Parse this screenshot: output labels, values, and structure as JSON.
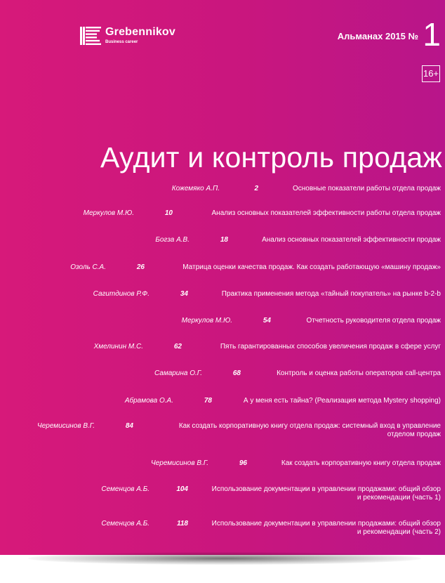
{
  "brand": {
    "name": "Grebennikov",
    "tagline": "Business career",
    "icon": "grebennikov-logo-icon"
  },
  "header": {
    "almanac_label": "Альманах 2015 №",
    "issue_number": "1",
    "age_rating": "16+"
  },
  "title": "Аудит и контроль продаж",
  "colors": {
    "background": "#d01880",
    "text": "#ffffff"
  },
  "toc": [
    {
      "author": "Кожемяко А.П.",
      "page": "2",
      "title": "Основные показатели работы отдела продаж"
    },
    {
      "author": "Меркулов М.Ю.",
      "page": "10",
      "title": "Анализ основных показателей эффективности работы отдела продаж"
    },
    {
      "author": "Богза А.В.",
      "page": "18",
      "title": "Анализ основных показателей эффективности продаж"
    },
    {
      "author": "Озоль С.А.",
      "page": "26",
      "title": "Матрица оценки качества продаж. Как создать работающую «машину продаж»"
    },
    {
      "author": "Сагитдинов Р.Ф.",
      "page": "34",
      "title": "Практика применения метода «тайный покупатель» на рынке b-2-b"
    },
    {
      "author": "Меркулов М.Ю.",
      "page": "54",
      "title": "Отчетность руководителя отдела продаж"
    },
    {
      "author": "Хмелинин М.С.",
      "page": "62",
      "title": "Пять гарантированных способов увеличения продаж в сфере услуг"
    },
    {
      "author": "Самарина О.Г.",
      "page": "68",
      "title": "Контроль и оценка работы операторов call-центра"
    },
    {
      "author": "Абрамова О.А.",
      "page": "78",
      "title": "А у меня есть тайна? (Реализация метода Mystery shopping)"
    },
    {
      "author": "Черемисинов В.Г.",
      "page": "84",
      "title_lines": [
        "Как создать корпоративную книгу отдела продаж: системный вход в управление",
        "отделом продаж"
      ]
    },
    {
      "author": "Черемисинов В.Г.",
      "page": "96",
      "title": "Как создать корпоративную книгу отдела продаж"
    },
    {
      "author": "Семенцов А.Б.",
      "page": "104",
      "title_lines": [
        "Использование документации в управлении продажами: общий обзор",
        "и рекомендации (часть 1)"
      ]
    },
    {
      "author": "Семенцов А.Б.",
      "page": "118",
      "title_lines": [
        "Использование документации в управлении продажами: общий обзор",
        "и рекомендации (часть 2)"
      ]
    }
  ]
}
